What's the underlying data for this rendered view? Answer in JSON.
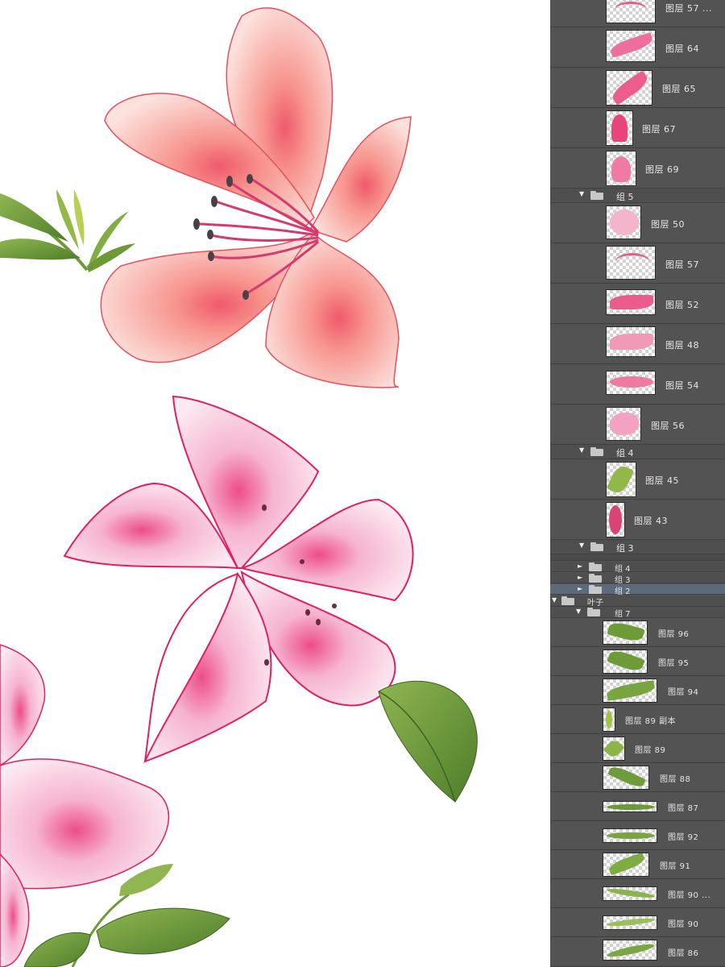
{
  "canvas": {
    "artwork": [
      "orange-lily-illustration",
      "pink-lily-illustration",
      "partial-pink-lily-illustration",
      "leaves-and-buds"
    ]
  },
  "layers_panel": {
    "flower_layers_top": [
      {
        "label": "图层 57 ...",
        "thumb": "petal-strokes"
      },
      {
        "label": "图层 64",
        "thumb": "petal"
      },
      {
        "label": "图层 65",
        "thumb": "petal"
      },
      {
        "label": "图层 67",
        "thumb": "petal"
      },
      {
        "label": "图层 69",
        "thumb": "petal"
      }
    ],
    "group5": {
      "label": "组 5"
    },
    "group5_layers": [
      {
        "label": "图层 50",
        "thumb": "petal"
      },
      {
        "label": "图层 57",
        "thumb": "petal-strokes"
      },
      {
        "label": "图层 52",
        "thumb": "petal"
      },
      {
        "label": "图层 48",
        "thumb": "petal"
      },
      {
        "label": "图层 54",
        "thumb": "petal"
      },
      {
        "label": "图层 56",
        "thumb": "petal"
      }
    ],
    "group4_open": {
      "label": "组 4"
    },
    "group4_layers": [
      {
        "label": "图层 45",
        "thumb": "leaf"
      },
      {
        "label": "图层 43",
        "thumb": "bud"
      }
    ],
    "group3_open": {
      "label": "组 3"
    },
    "collapsed_groups": [
      {
        "label": "组 4"
      },
      {
        "label": "组 3"
      },
      {
        "label": "组 2"
      }
    ],
    "leaves_group": {
      "label": "叶子"
    },
    "group7": {
      "label": "组 7"
    },
    "leaf_layers": [
      {
        "label": "图层 96",
        "thumb": "leaf"
      },
      {
        "label": "图层 95",
        "thumb": "leaf"
      },
      {
        "label": "图层 94",
        "thumb": "leaf"
      },
      {
        "label": "图层 89 副本",
        "thumb": "leaf"
      },
      {
        "label": "图层 89",
        "thumb": "leaf"
      },
      {
        "label": "图层 88",
        "thumb": "leaf"
      },
      {
        "label": "图层 87",
        "thumb": "leaf"
      },
      {
        "label": "图层 92",
        "thumb": "leaf"
      },
      {
        "label": "图层 91",
        "thumb": "leaf"
      },
      {
        "label": "图层 90 ...",
        "thumb": "leaf"
      },
      {
        "label": "图层 90",
        "thumb": "leaf"
      },
      {
        "label": "图层 86",
        "thumb": "leaf"
      }
    ]
  },
  "colors": {
    "panel_bg": "#535353",
    "selected_row": "#5c6a7c",
    "petal_orange": "#f6a7a0",
    "petal_pink": "#f3a9c6",
    "leaf_green": "#6a9a3a"
  }
}
